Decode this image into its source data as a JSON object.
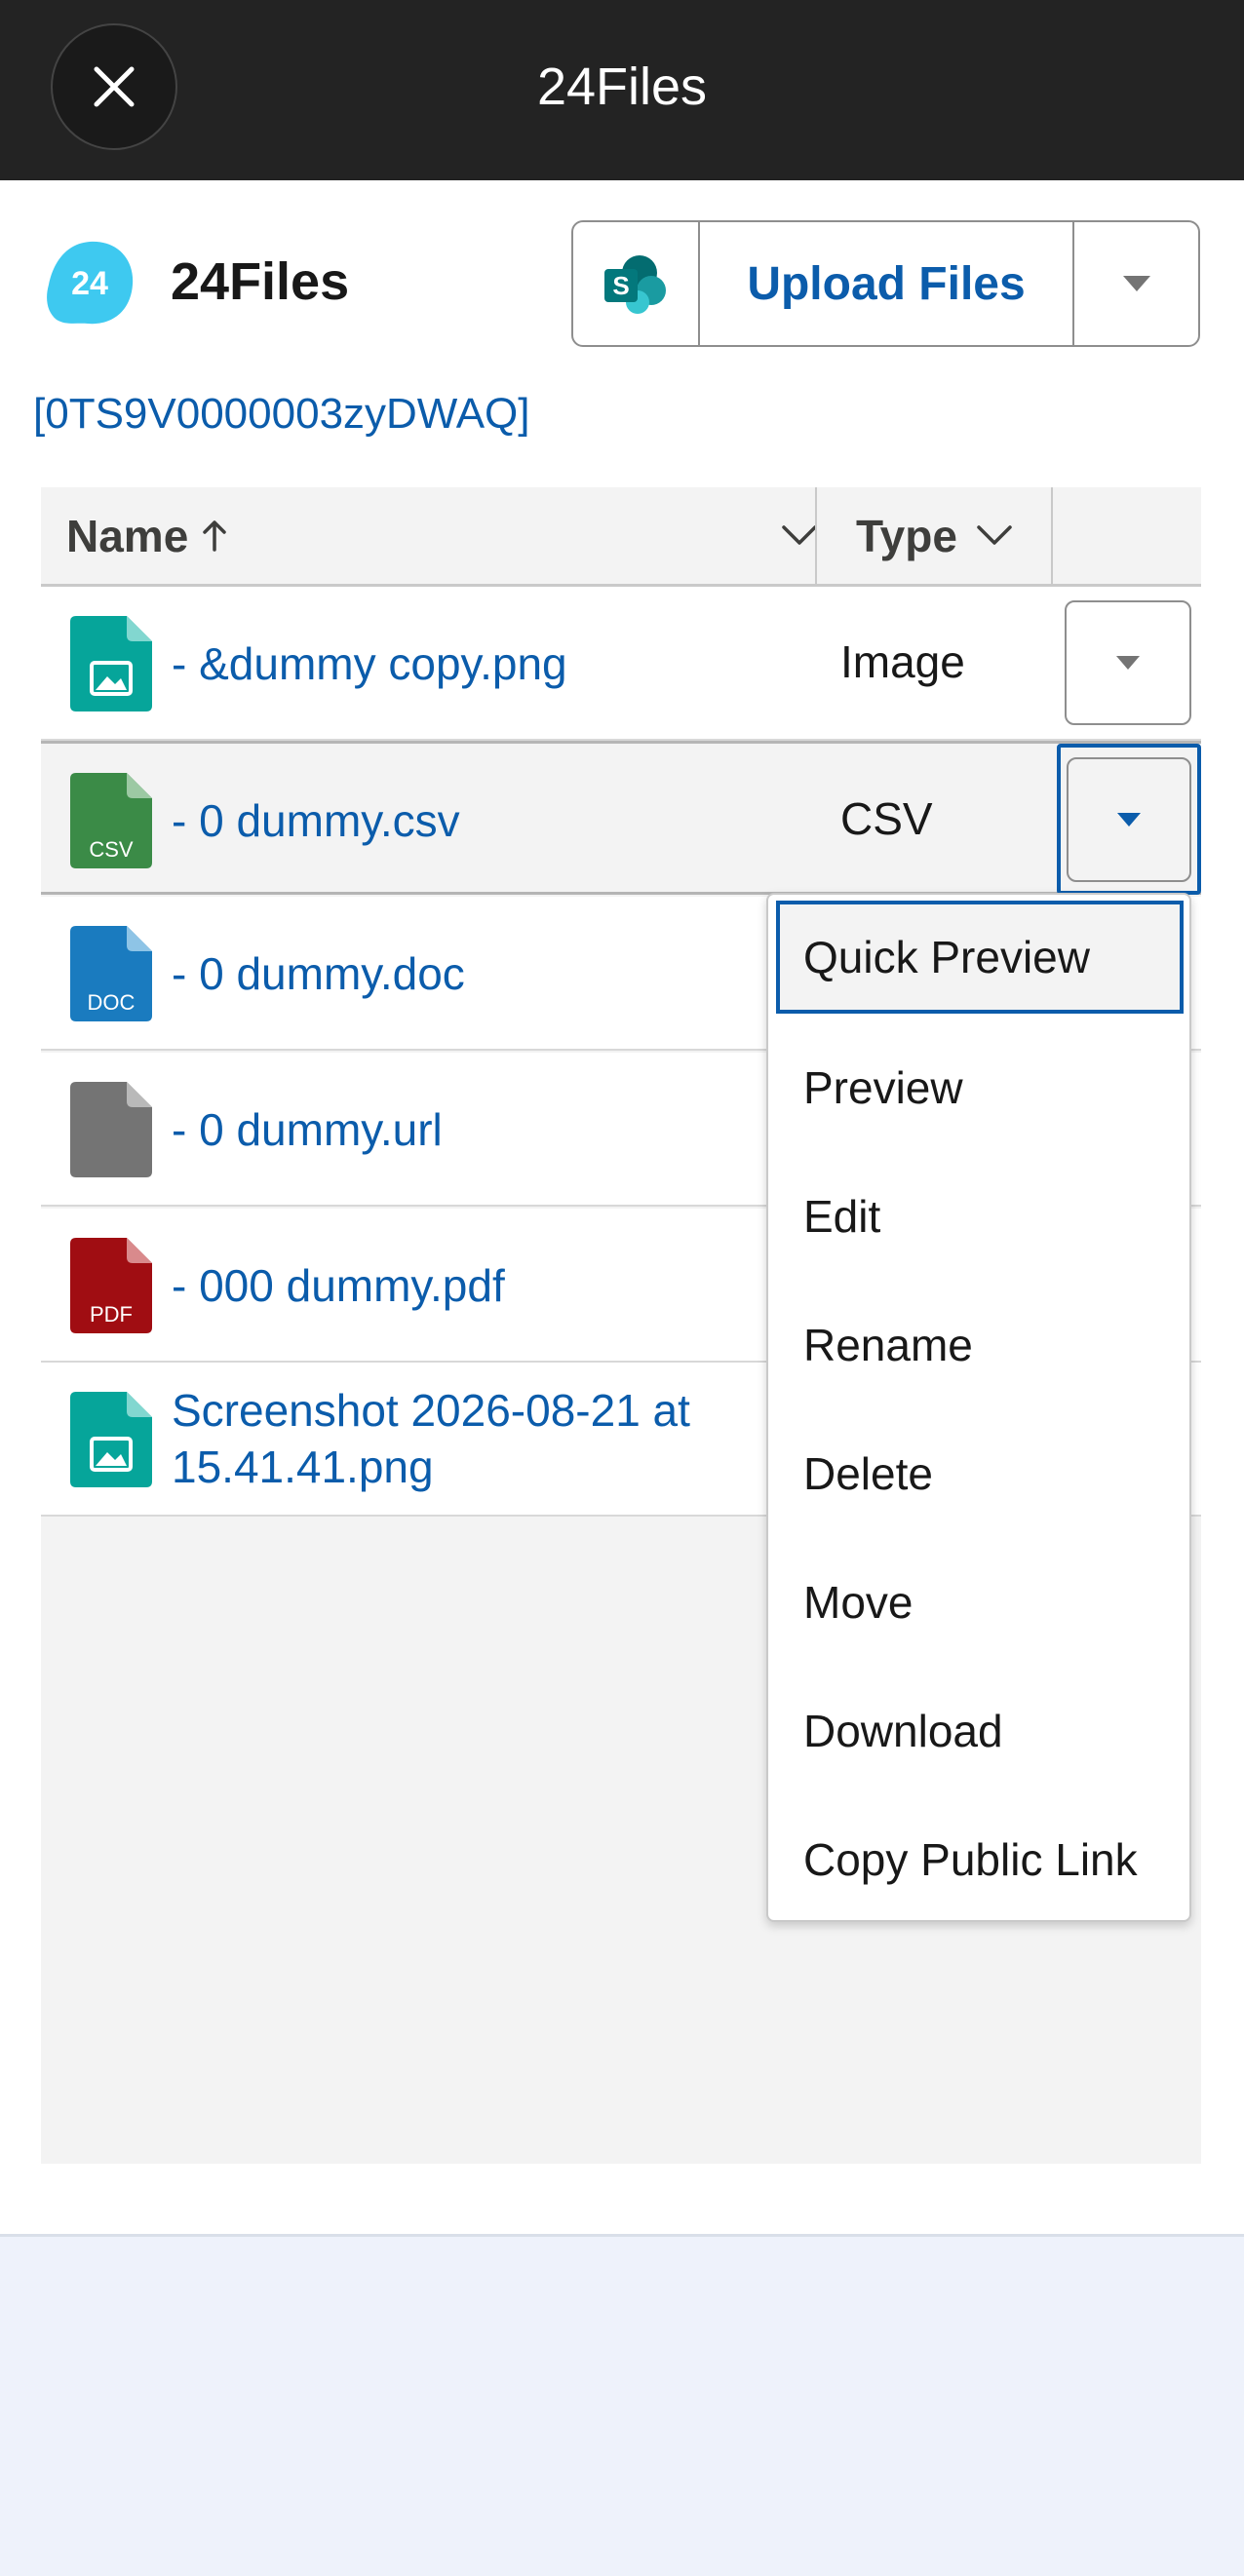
{
  "topbar": {
    "title": "24Files",
    "close_icon": "close-icon"
  },
  "app": {
    "name": "24Files",
    "logo_text": "24",
    "record_id": "[0TS9V0000003zyDWAQ]"
  },
  "toolbar": {
    "sharepoint_icon": "sharepoint-icon",
    "sharepoint_letter": "S",
    "upload_label": "Upload Files",
    "menu_icon": "chevron-down-icon"
  },
  "table": {
    "columns": [
      {
        "label": "Name",
        "sort": "ascending"
      },
      {
        "label": "Type"
      }
    ],
    "rows": [
      {
        "name": "- &dummy copy.png",
        "type": "Image",
        "icon": "image-file-icon",
        "icon_color": "#06a59a",
        "badge": ""
      },
      {
        "name": "- 0 dummy.csv",
        "type": "CSV",
        "icon": "csv-file-icon",
        "icon_color": "#3b8b47",
        "badge": "CSV",
        "selected": true
      },
      {
        "name": "- 0 dummy.doc",
        "type": "",
        "icon": "doc-file-icon",
        "icon_color": "#1a7bbf",
        "badge": "DOC"
      },
      {
        "name": "- 0 dummy.url",
        "type": "",
        "icon": "generic-file-icon",
        "icon_color": "#747474",
        "badge": ""
      },
      {
        "name": "- 000 dummy.pdf",
        "type": "",
        "icon": "pdf-file-icon",
        "icon_color": "#a00d12",
        "badge": "PDF"
      },
      {
        "name": "Screenshot 2026-08-21 at 15.41.41.png",
        "type": "",
        "icon": "image-file-icon",
        "icon_color": "#06a59a",
        "badge": ""
      }
    ]
  },
  "row_menu": {
    "items": [
      "Quick Preview",
      "Preview",
      "Edit",
      "Rename",
      "Delete",
      "Move",
      "Download",
      "Copy Public Link"
    ],
    "active_index": 0
  },
  "colors": {
    "link": "#0b5cab",
    "topbar": "#232323",
    "logo": "#3ec9f0"
  }
}
